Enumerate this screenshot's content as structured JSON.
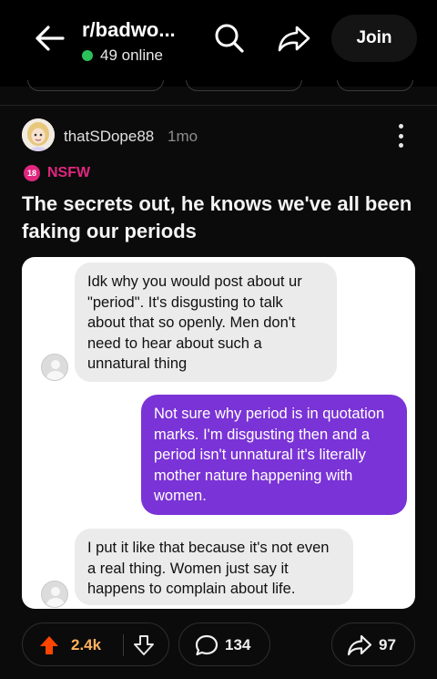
{
  "header": {
    "subreddit": "r/badwo...",
    "online_count": "49 online",
    "join_label": "Join"
  },
  "post": {
    "author": "thatSDope88",
    "age": "1mo",
    "nsfw_badge": "18",
    "nsfw_label": "NSFW",
    "title": "The secrets out, he knows we've all been faking our periods"
  },
  "screenshot_messages": [
    {
      "side": "left",
      "text": "Idk why you would post about ur \"period\". It's disgusting to talk about that so openly. Men don't need to hear about such a unnatural thing"
    },
    {
      "side": "right",
      "text": "Not sure why period is in quotation marks. I'm disgusting then and a period isn't unnatural it's literally mother nature happening with women."
    },
    {
      "side": "left",
      "text": "I put it like that because it's not even a real thing. Women just say it happens to complain about life."
    }
  ],
  "actions": {
    "score": "2.4k",
    "comments": "134",
    "shares": "97"
  },
  "colors": {
    "accent_upvote": "#ff4500",
    "score_text": "#ffb15e",
    "nsfw": "#e0267f",
    "online_dot": "#2bc05a",
    "sent_bubble": "#7a33d6",
    "received_bubble": "#ebebeb"
  },
  "icons": [
    "back-arrow-icon",
    "search-icon",
    "share-icon",
    "more-vertical-icon",
    "upvote-icon",
    "downvote-icon",
    "comment-icon"
  ]
}
